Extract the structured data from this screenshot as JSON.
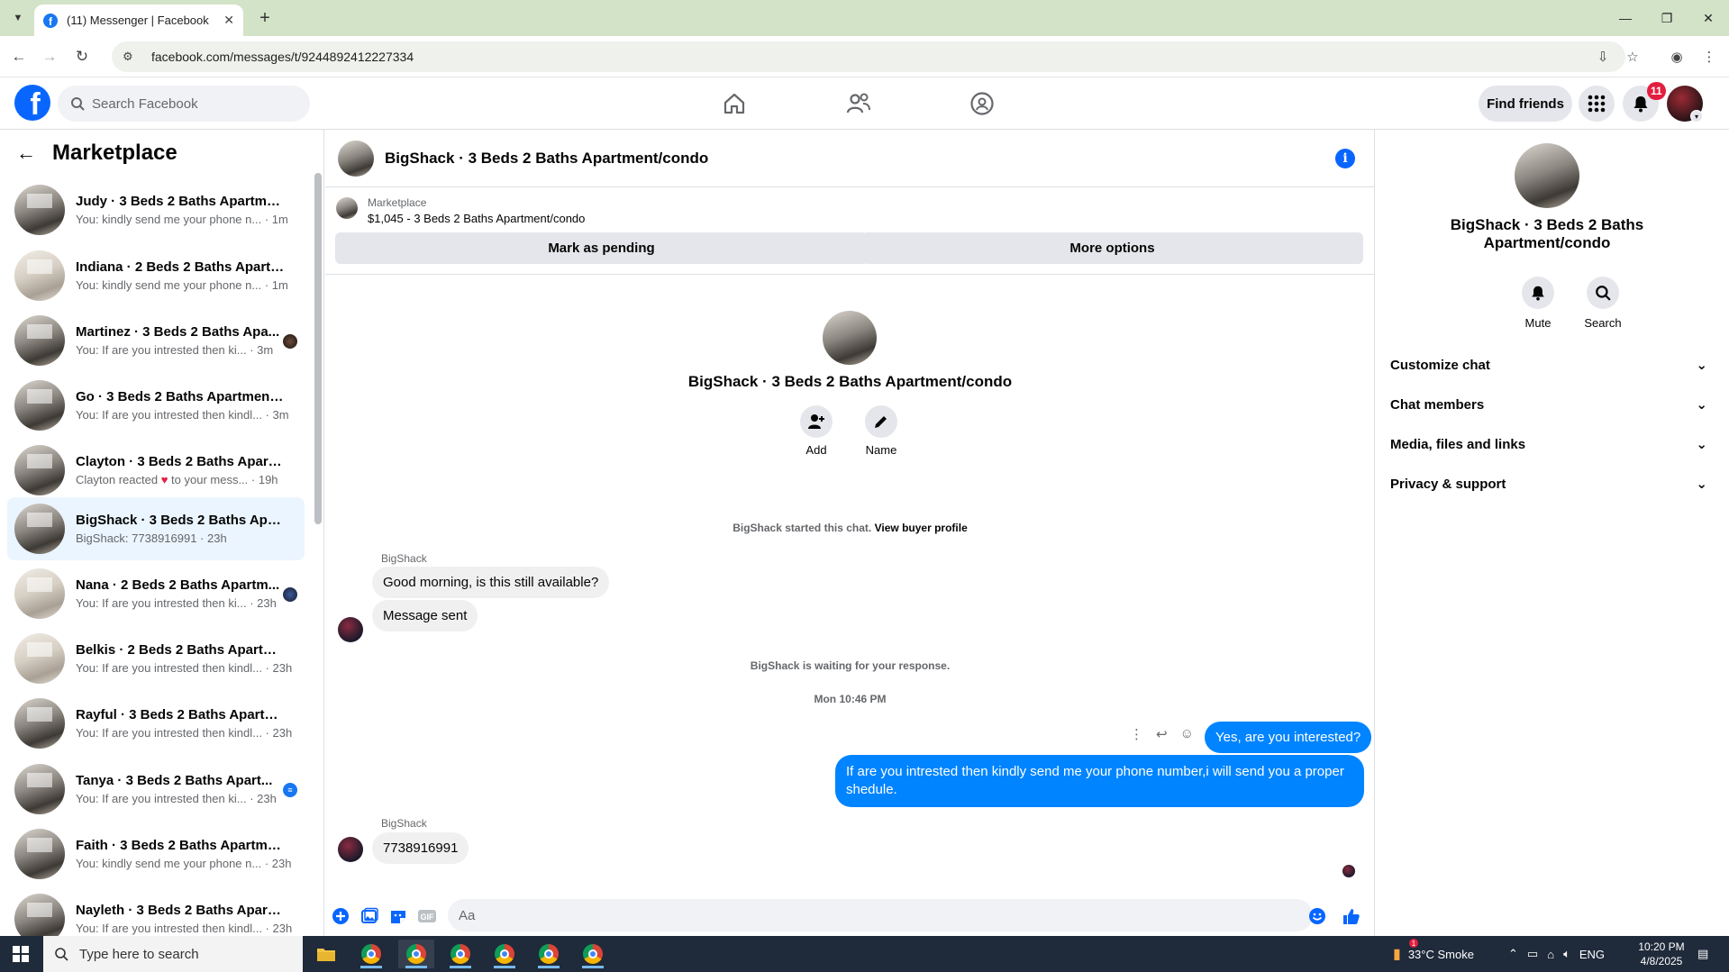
{
  "browser": {
    "tab_title": "(11) Messenger | Facebook",
    "url": "facebook.com/messages/t/9244892412227334",
    "new_tab": "+",
    "close_tab": "✕"
  },
  "fb_header": {
    "search_placeholder": "Search Facebook",
    "find_friends": "Find friends",
    "notification_count": "11"
  },
  "sidebar": {
    "title": "Marketplace",
    "conversations": [
      {
        "name": "Judy · 3 Beds 2 Baths Apartment...",
        "preview": "You: kindly send me your phone n... · 1m",
        "light": false
      },
      {
        "name": "Indiana · 2 Beds 2 Baths Apartm...",
        "preview": "You: kindly send me your phone n... · 1m",
        "light": true
      },
      {
        "name": "Martinez · 3 Beds 2 Baths Apa...",
        "preview": "You: If are you intrested then ki... · 3m",
        "light": false
      },
      {
        "name": "Go · 3 Beds 2 Baths Apartment/...",
        "preview": "You: If are you intrested then kindl... · 3m",
        "light": false
      },
      {
        "name": "Clayton · 3 Beds 2 Baths Apartm...",
        "preview_a": "Clayton reacted",
        "preview_b": "to your mess... · 19h",
        "light": false
      },
      {
        "name": "BigShack · 3 Beds 2 Baths Apart...",
        "preview": "BigShack: 7738916991 · 23h",
        "light": false
      },
      {
        "name": "Nana · 2 Beds 2 Baths Apartm...",
        "preview": "You: If are you intrested then ki... · 23h",
        "light": true
      },
      {
        "name": "Belkis · 2 Beds 2 Baths Apartme...",
        "preview": "You: If are you intrested then kindl... · 23h",
        "light": true
      },
      {
        "name": "Rayful · 3 Beds 2 Baths Apartme...",
        "preview": "You: If are you intrested then kindl... · 23h",
        "light": false
      },
      {
        "name": "Tanya · 3 Beds 2 Baths Apart...",
        "preview": "You: If are you intrested then ki... · 23h",
        "light": false
      },
      {
        "name": "Faith · 3 Beds 2 Baths Apartmen...",
        "preview": "You: kindly send me your phone n... · 23h",
        "light": false
      },
      {
        "name": "Nayleth · 3 Beds 2 Baths Apartm...",
        "preview": "You: If are you intrested then kindl... · 23h",
        "light": false
      }
    ]
  },
  "chat": {
    "title": "BigShack · 3 Beds 2 Baths Apartment/condo",
    "marketplace_label": "Marketplace",
    "listing": "$1,045 - 3 Beds 2 Baths Apartment/condo",
    "mark_pending": "Mark as pending",
    "more_options": "More options",
    "intro_name": "BigShack · 3 Beds 2 Baths Apartment/condo",
    "add_label": "Add",
    "name_label": "Name",
    "started_text": "BigShack started this chat.",
    "view_buyer": "View buyer profile",
    "sender_1": "BigShack",
    "msg_1": "Good morning, is this still available?",
    "msg_2": "Message sent",
    "waiting": "BigShack is waiting for your response.",
    "timestamp": "Mon 10:46 PM",
    "out_1": "Yes, are you interested?",
    "out_2": "If are you intrested then kindly send me your phone number,i will send you a proper shedule.",
    "sender_2": "BigShack",
    "msg_3": "7738916991",
    "composer_placeholder": "Aa"
  },
  "right_panel": {
    "name": "BigShack · 3 Beds 2 Baths Apartment/condo",
    "mute": "Mute",
    "search": "Search",
    "rows": [
      "Customize chat",
      "Chat members",
      "Media, files and links",
      "Privacy & support"
    ]
  },
  "taskbar": {
    "search_placeholder": "Type here to search",
    "weather": "33°C  Smoke",
    "weather_badge": "1",
    "lang": "ENG",
    "time": "10:20 PM",
    "date": "4/8/2025"
  }
}
